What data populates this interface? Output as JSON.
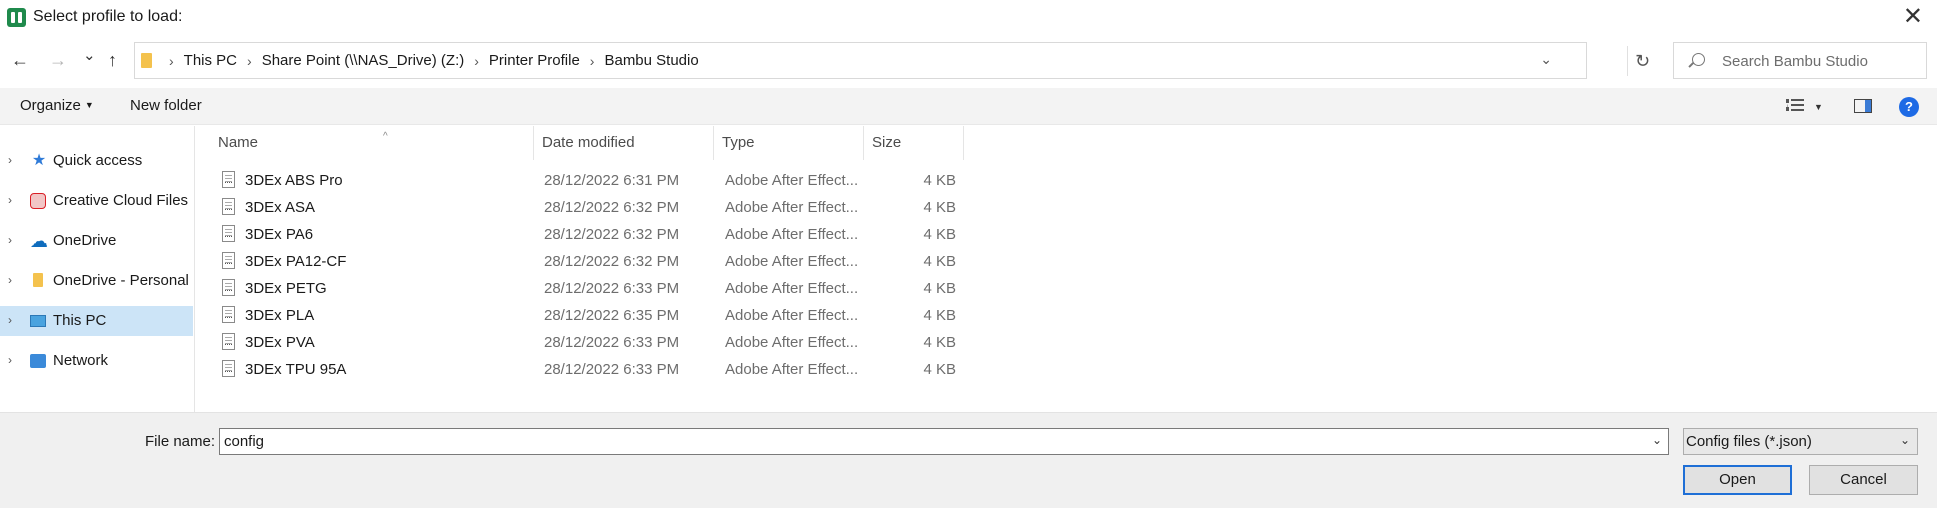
{
  "window": {
    "title": "Select profile to load:",
    "close_glyph": "✕"
  },
  "navigation": {
    "back_glyph": "←",
    "forward_glyph": "→",
    "recent_glyph": "⌄",
    "up_glyph": "↑",
    "breadcrumbs": [
      "This PC",
      "Share Point (\\\\NAS_Drive) (Z:)",
      "Printer Profile",
      "Bambu Studio"
    ],
    "separator_glyph": "›",
    "dropdown_glyph": "⌄",
    "refresh_glyph": "↻",
    "search_placeholder": "Search Bambu Studio"
  },
  "toolbar": {
    "organize_label": "Organize",
    "new_folder_label": "New folder",
    "help_glyph": "?"
  },
  "sidebar": {
    "items": [
      {
        "label": "Quick access",
        "icon": "star-icon"
      },
      {
        "label": "Creative Cloud Files",
        "icon": "creative-cloud-icon"
      },
      {
        "label": "OneDrive",
        "icon": "cloud-icon"
      },
      {
        "label": "OneDrive - Personal",
        "icon": "folder-icon"
      },
      {
        "label": "This PC",
        "icon": "computer-icon",
        "selected": true
      },
      {
        "label": "Network",
        "icon": "network-icon"
      }
    ],
    "chevron_glyph": "›"
  },
  "file_list": {
    "columns": {
      "name": "Name",
      "date": "Date modified",
      "type": "Type",
      "size": "Size"
    },
    "sort_glyph": "^",
    "rows": [
      {
        "name": "3DEx ABS Pro",
        "date": "28/12/2022 6:31 PM",
        "type": "Adobe After Effect...",
        "size": "4 KB"
      },
      {
        "name": "3DEx ASA",
        "date": "28/12/2022 6:32 PM",
        "type": "Adobe After Effect...",
        "size": "4 KB"
      },
      {
        "name": "3DEx PA6",
        "date": "28/12/2022 6:32 PM",
        "type": "Adobe After Effect...",
        "size": "4 KB"
      },
      {
        "name": "3DEx PA12-CF",
        "date": "28/12/2022 6:32 PM",
        "type": "Adobe After Effect...",
        "size": "4 KB"
      },
      {
        "name": "3DEx PETG",
        "date": "28/12/2022 6:33 PM",
        "type": "Adobe After Effect...",
        "size": "4 KB"
      },
      {
        "name": "3DEx PLA",
        "date": "28/12/2022 6:35 PM",
        "type": "Adobe After Effect...",
        "size": "4 KB"
      },
      {
        "name": "3DEx PVA",
        "date": "28/12/2022 6:33 PM",
        "type": "Adobe After Effect...",
        "size": "4 KB"
      },
      {
        "name": "3DEx TPU 95A",
        "date": "28/12/2022 6:33 PM",
        "type": "Adobe After Effect...",
        "size": "4 KB"
      }
    ]
  },
  "footer": {
    "file_name_label": "File name:",
    "file_name_value": "config",
    "file_type_value": "Config files (*.json)",
    "dropdown_glyph": "⌄",
    "open_label": "Open",
    "cancel_label": "Cancel"
  }
}
